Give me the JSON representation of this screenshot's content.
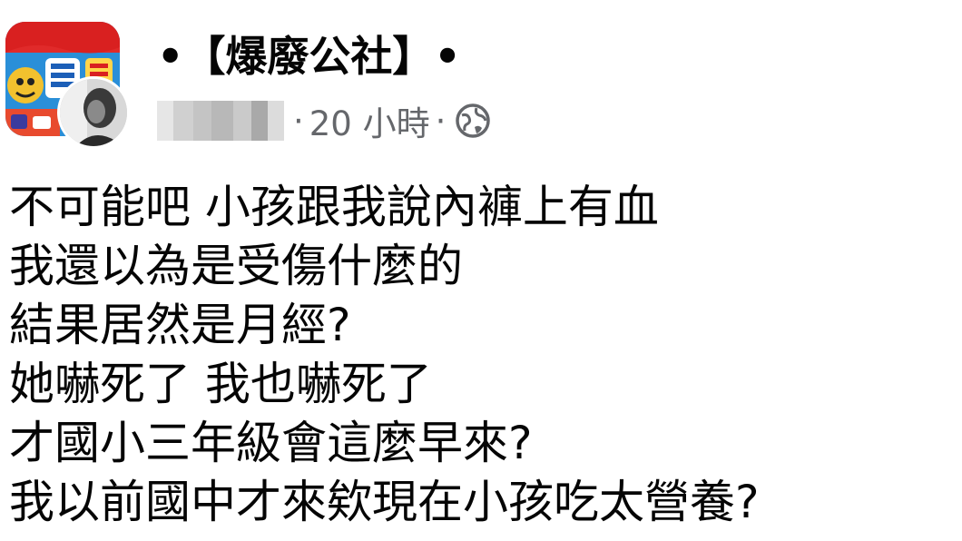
{
  "post": {
    "group_name": "•【爆廢公社】•",
    "timestamp": "20 小時",
    "separator": "·",
    "privacy_icon": "public-globe-icon",
    "group_avatar_icon": "group-avatar",
    "user_avatar_icon": "user-avatar",
    "author_name_blurred": true,
    "lines": [
      "不可能吧 小孩跟我說內褲上有血",
      "我還以為是受傷什麼的",
      "結果居然是月經?",
      "她嚇死了 我也嚇死了",
      "才國小三年級會這麼早來?",
      "我以前國中才來欸現在小孩吃太營養?"
    ]
  },
  "colors": {
    "text": "#050505",
    "meta": "#65676b",
    "background": "#ffffff"
  }
}
